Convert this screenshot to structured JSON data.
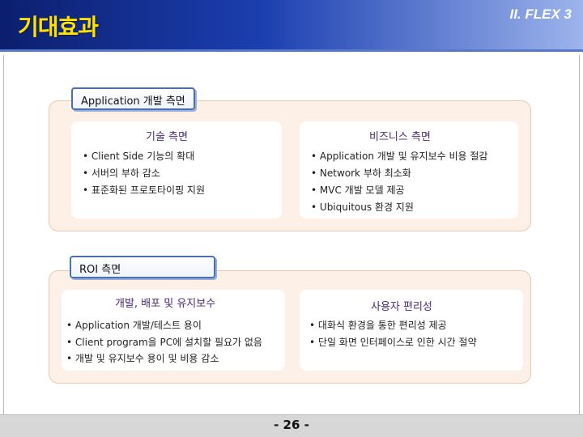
{
  "header": {
    "title": "기대효과",
    "section": "II. FLEX 3"
  },
  "application": {
    "label": "Application 개발 측면",
    "tech": {
      "title": "기술 측면",
      "items": [
        "Client Side 기능의 확대",
        "서버의 부하 감소",
        "표준화된 프로토타이핑 지원"
      ]
    },
    "business": {
      "title": "비즈니스 측면",
      "items": [
        "Application 개발 및 유지보수 비용 절감",
        "Network 부하 최소화",
        "MVC 개발 모델 제공",
        "Ubiquitous 환경 지원"
      ]
    }
  },
  "roi": {
    "label": "ROI 측면",
    "dev": {
      "title": "개발, 배포 및 유지보수",
      "items": [
        "Application 개발/테스트 용이",
        "Client program을 PC에 설치할 필요가 없음",
        "개발 및 유지보수 용이 및 비용 감소"
      ]
    },
    "user": {
      "title": "사용자 편리성",
      "items": [
        "대화식 환경을 통한 편리성 제공",
        "단일 화면 인터페이스로 인한 시간 절약"
      ]
    }
  },
  "footer": {
    "page": "- 26 -"
  }
}
